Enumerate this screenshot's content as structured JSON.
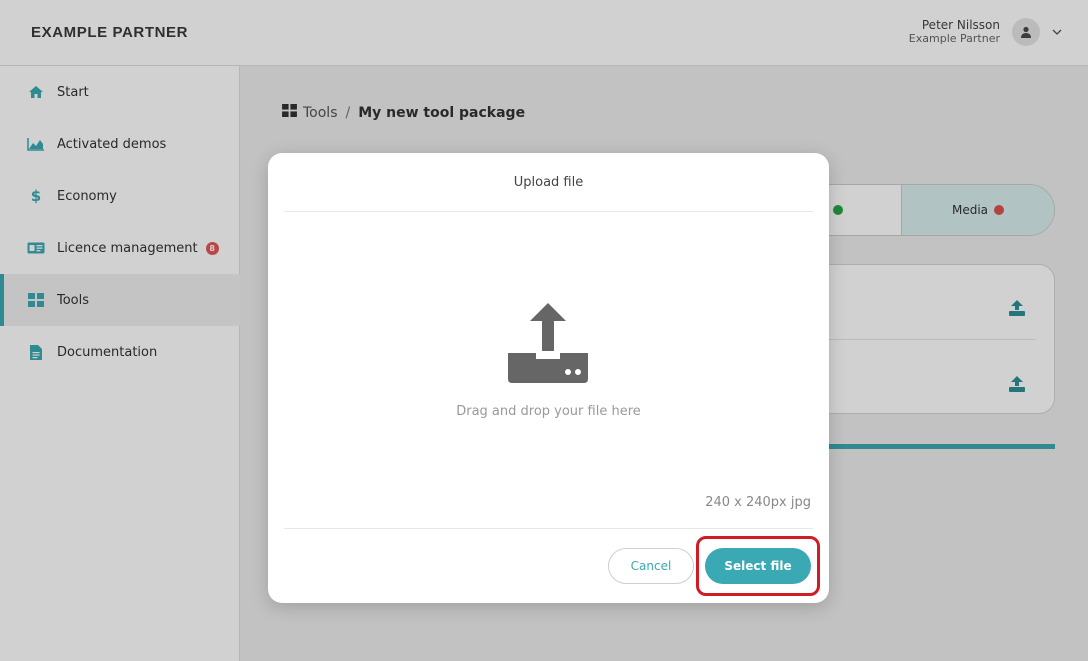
{
  "header": {
    "brand": "EXAMPLE PARTNER",
    "user_name": "Peter Nilsson",
    "user_org": "Example Partner"
  },
  "sidebar": {
    "items": [
      {
        "label": "Start",
        "icon": "home-icon"
      },
      {
        "label": "Activated demos",
        "icon": "area-chart-icon"
      },
      {
        "label": "Economy",
        "icon": "dollar-icon"
      },
      {
        "label": "Licence management",
        "icon": "id-card-icon",
        "badge": "8"
      },
      {
        "label": "Tools",
        "icon": "grid-icon",
        "active": true
      },
      {
        "label": "Documentation",
        "icon": "file-icon"
      }
    ]
  },
  "breadcrumb": {
    "root": "Tools",
    "separator": "/",
    "current": "My new tool package"
  },
  "tabs": {
    "media": "Media"
  },
  "modal": {
    "title": "Upload file",
    "drop_text": "Drag and drop your file here",
    "size_hint": "240 x 240px jpg",
    "cancel_label": "Cancel",
    "select_label": "Select file"
  },
  "colors": {
    "accent": "#3aa9b3",
    "highlight": "#d01c24",
    "error": "#d9534f",
    "success": "#28a745"
  }
}
